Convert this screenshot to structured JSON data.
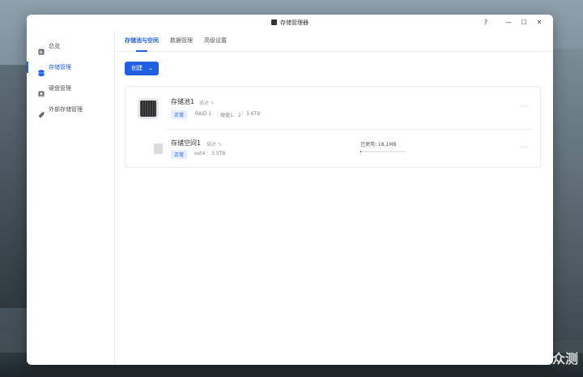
{
  "window": {
    "title": "存储管理器"
  },
  "controls": {
    "help": "?",
    "minimize": "—",
    "maximize": "☐",
    "close": "✕"
  },
  "sidebar": {
    "items": [
      {
        "label": "总览",
        "icon": "overview-icon"
      },
      {
        "label": "存储管理",
        "icon": "database-icon",
        "active": true
      },
      {
        "label": "硬盘管理",
        "icon": "disk-icon"
      },
      {
        "label": "外部存储管理",
        "icon": "usb-icon"
      }
    ]
  },
  "tabs": [
    {
      "label": "存储池与空间",
      "active": true
    },
    {
      "label": "数据管理"
    },
    {
      "label": "高级设置"
    }
  ],
  "toolbar": {
    "create_label": "创建",
    "create_chevron": "⌄"
  },
  "pool": {
    "name": "存储池1",
    "desc_label": "描述",
    "status": "正常",
    "raid": "RAID 1",
    "disks": "硬盘1、2",
    "size": "3.6TB",
    "more": "···"
  },
  "volume": {
    "name": "存储空间1",
    "desc_label": "描述",
    "status": "正常",
    "fs": "ext4",
    "size": "3.5TB",
    "used_label": "已使用: 18.1MB",
    "used_fraction": 0.005,
    "more": "···"
  },
  "watermark": "新 浪 众测",
  "colors": {
    "accent": "#1f5fe0",
    "badge_bg": "#e5eefe"
  }
}
